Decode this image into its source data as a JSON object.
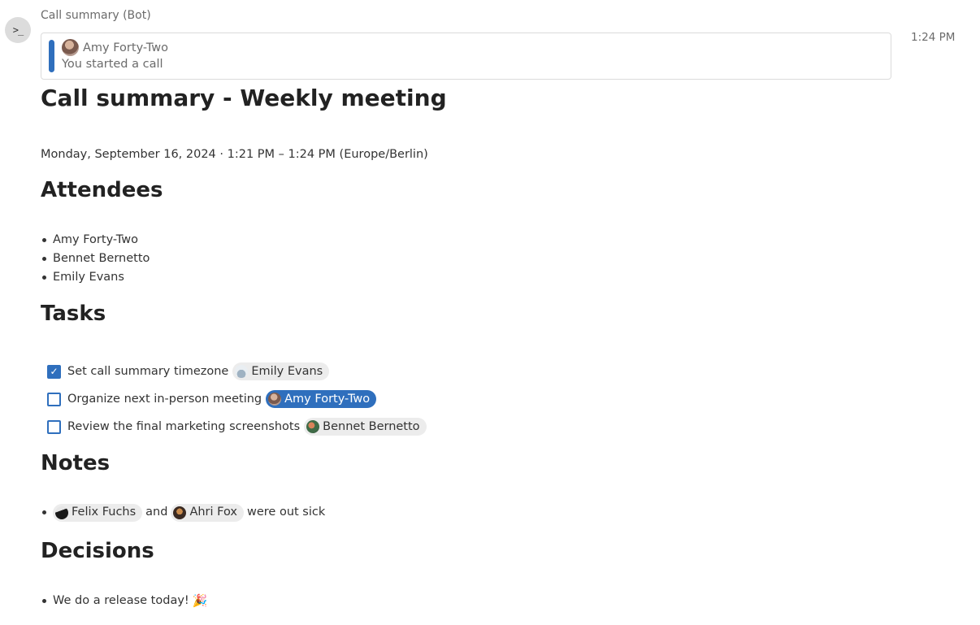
{
  "message": {
    "author": "Call summary (Bot)",
    "time": "1:24 PM",
    "bot_avatar_glyph": ">_",
    "quote": {
      "author": "Amy Forty-Two",
      "text": "You started a call"
    }
  },
  "summary": {
    "title": "Call summary - Weekly meeting",
    "date_line": "Monday, September 16, 2024  ·  1:21 PM – 1:24 PM (Europe/Berlin)",
    "attendees_heading": "Attendees",
    "attendees": [
      "Amy Forty-Two",
      "Bennet Bernetto",
      "Emily Evans"
    ],
    "tasks_heading": "Tasks",
    "tasks": [
      {
        "text": "Set call summary timezone",
        "assignee": "Emily Evans",
        "checked": true
      },
      {
        "text": "Organize next in-person meeting",
        "assignee": "Amy Forty-Two",
        "checked": false
      },
      {
        "text": "Review the final marketing screenshots",
        "assignee": "Bennet Bernetto",
        "checked": false
      }
    ],
    "notes_heading": "Notes",
    "notes": {
      "person_1": "Felix Fuchs",
      "joiner": "and",
      "person_2": "Ahri Fox",
      "rest": "were out sick"
    },
    "decisions_heading": "Decisions",
    "decisions": [
      "We do a release today!"
    ],
    "decision_emoji": "🎉"
  },
  "colors": {
    "accent": "#2f6fbd",
    "mention_bg": "#ececec",
    "muted_text": "#6b6b6b"
  }
}
